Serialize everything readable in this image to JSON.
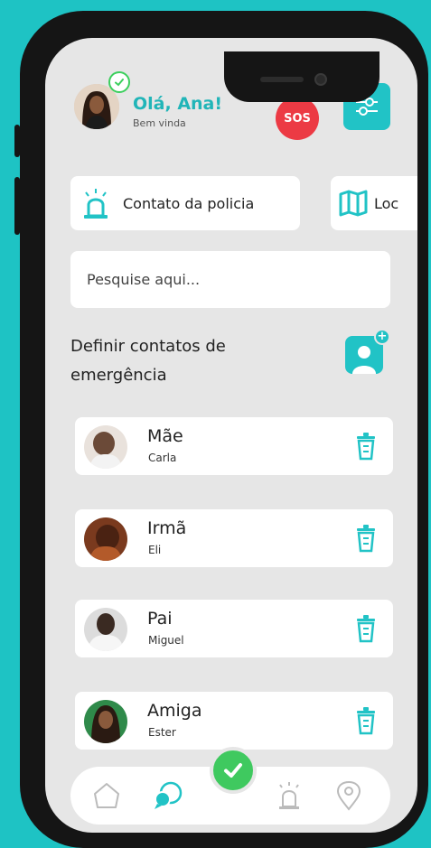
{
  "header": {
    "greeting": "Olá, Ana!",
    "subtitle": "Bem vinda",
    "sos_label": "SOS"
  },
  "quick_actions": [
    {
      "label": "Contato da policia"
    },
    {
      "label": "Loc"
    }
  ],
  "search": {
    "placeholder": "Pesquise aqui...",
    "value": ""
  },
  "emergency_section": {
    "title": "Definir contatos de emergência"
  },
  "contacts": [
    {
      "relation": "Mãe",
      "name": "Carla"
    },
    {
      "relation": "Irmã",
      "name": "Eli"
    },
    {
      "relation": "Pai",
      "name": "Miguel"
    },
    {
      "relation": "Amiga",
      "name": "Ester"
    }
  ],
  "tabs": [
    "home-icon",
    "chat-icon",
    "siren-icon",
    "location-icon"
  ],
  "colors": {
    "accent": "#21c3c6",
    "sos": "#ec3a44",
    "success": "#3fc95f",
    "background": "#1ec3c4"
  }
}
